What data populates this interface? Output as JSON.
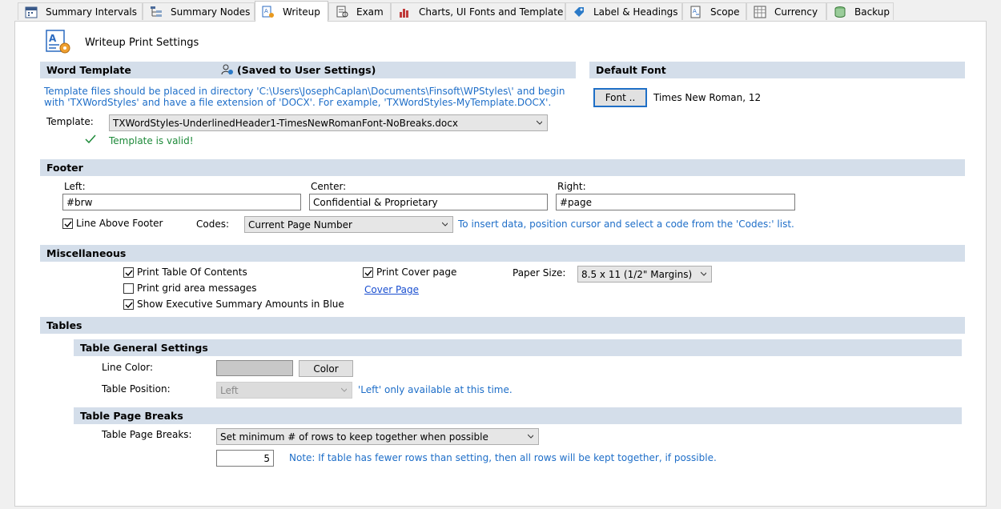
{
  "tabs": [
    {
      "label": "Summary Intervals",
      "icon": "calendar-icon"
    },
    {
      "label": "Summary Nodes",
      "icon": "tree-icon"
    },
    {
      "label": "Writeup",
      "icon": "document-gear-icon"
    },
    {
      "label": "Exam",
      "icon": "exam-icon"
    },
    {
      "label": "Charts, UI Fonts and Template",
      "icon": "chart-icon"
    },
    {
      "label": "Label & Headings",
      "icon": "tag-icon"
    },
    {
      "label": "Scope",
      "icon": "scope-icon"
    },
    {
      "label": "Currency",
      "icon": "currency-icon"
    },
    {
      "label": "Backup",
      "icon": "backup-icon"
    }
  ],
  "page": {
    "title": "Writeup Print Settings"
  },
  "word_template": {
    "header": "Word Template",
    "saved_note": "(Saved to User Settings)",
    "instructions_line1": "Template files should be placed in directory 'C:\\Users\\JosephCaplan\\Documents\\Finsoft\\WPStyles\\' and begin",
    "instructions_line2": "with 'TXWordStyles' and have a file extension of 'DOCX'.  For example, 'TXWordStyles-MyTemplate.DOCX'.",
    "template_label": "Template:",
    "template_value": "TXWordStyles-UnderlinedHeader1-TimesNewRomanFont-NoBreaks.docx",
    "valid_message": "Template is valid!"
  },
  "default_font": {
    "header": "Default Font",
    "button_label": "Font ..",
    "font_value": "Times New Roman, 12"
  },
  "footer": {
    "header": "Footer",
    "left_label": "Left:",
    "left_value": "#brw",
    "center_label": "Center:",
    "center_value": "Confidential & Proprietary",
    "right_label": "Right:",
    "right_value": "#page",
    "line_above_label": "Line Above Footer",
    "codes_label": "Codes:",
    "codes_value": "Current Page Number",
    "codes_hint": "To insert data, position cursor and select a code from the 'Codes:' list."
  },
  "misc": {
    "header": "Miscellaneous",
    "print_toc": "Print Table Of Contents",
    "print_grid": "Print grid area messages",
    "show_exec": "Show Executive Summary Amounts in Blue",
    "print_cover": "Print Cover page",
    "cover_link": "Cover Page",
    "paper_label": "Paper Size:",
    "paper_value": "8.5 x 11 (1/2\" Margins)"
  },
  "tables": {
    "header": "Tables",
    "general_header": "Table General Settings",
    "line_color_label": "Line Color:",
    "line_color_value": "#c8c8c8",
    "color_button": "Color",
    "position_label": "Table Position:",
    "position_value": "Left",
    "position_note": "'Left' only available at this time.",
    "breaks_header": "Table Page Breaks",
    "breaks_label": "Table Page Breaks:",
    "breaks_value": "Set minimum # of rows to keep together when possible",
    "rows_value": "5",
    "rows_note": "Note:  If table has fewer rows than setting, then all rows will be kept together, if possible."
  },
  "colors": {
    "section_bg": "#d4deea",
    "accent_blue": "#1e6ec8",
    "valid_green": "#1e8a3a"
  }
}
